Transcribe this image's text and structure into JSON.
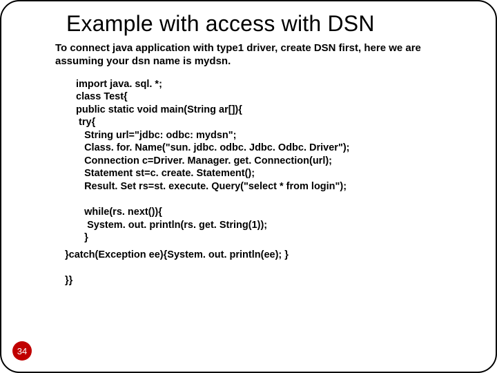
{
  "slide": {
    "title": "Example with access with DSN",
    "intro": "To connect java application with type1 driver, create DSN first, here we are assuming your dsn name is mydsn.",
    "page_number": "34"
  },
  "code": {
    "l01": "import java. sql. *;",
    "l02": "class Test{",
    "l03": "public static void main(String ar[]){",
    "l04": " try{",
    "l05": "   String url=\"jdbc: odbc: mydsn\";",
    "l06": "   Class. for. Name(\"sun. jdbc. odbc. Jdbc. Odbc. Driver\");",
    "l07": "   Connection c=Driver. Manager. get. Connection(url);",
    "l08": "   Statement st=c. create. Statement();",
    "l09": "   Result. Set rs=st. execute. Query(\"select * from login\");",
    "l10": "",
    "l11": "   while(rs. next()){",
    "l12": "    System. out. println(rs. get. String(1));",
    "l13": "   }",
    "l14": "",
    "l15": "}catch(Exception ee){System. out. println(ee); }",
    "l16": "",
    "l17": "}}"
  }
}
